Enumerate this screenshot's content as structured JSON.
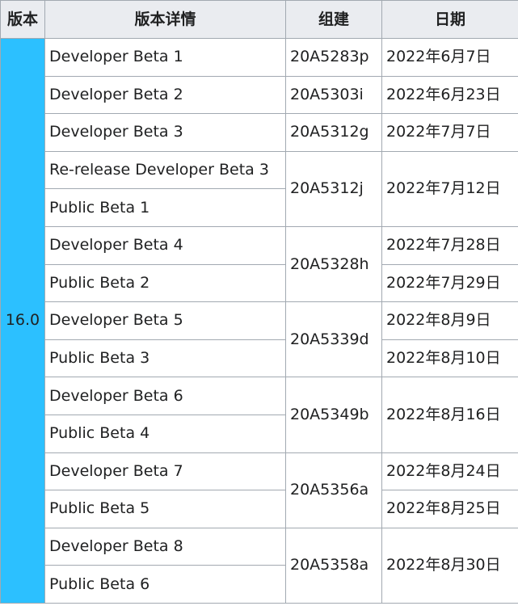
{
  "table": {
    "headers": {
      "version": "版本",
      "details": "版本详情",
      "build": "组建",
      "date": "日期"
    },
    "version": "16.0",
    "rows": [
      {
        "details": "Developer Beta 1",
        "build": "20A5283p",
        "date": "2022年6月7日"
      },
      {
        "details": "Developer Beta 2",
        "build": "20A5303i",
        "date": "2022年6月23日"
      },
      {
        "details": "Developer Beta 3",
        "build": "20A5312g",
        "date": "2022年7月7日"
      },
      {
        "details": "Re-release Developer Beta 3",
        "build": "20A5312j",
        "date": "2022年7月12日"
      },
      {
        "details": "Public Beta 1"
      },
      {
        "details": "Developer Beta 4",
        "build": "20A5328h",
        "date": "2022年7月28日"
      },
      {
        "details": "Public Beta 2",
        "date": "2022年7月29日"
      },
      {
        "details": "Developer Beta 5",
        "build": "20A5339d",
        "date": "2022年8月9日"
      },
      {
        "details": "Public Beta 3",
        "date": "2022年8月10日"
      },
      {
        "details": "Developer Beta 6",
        "build": "20A5349b",
        "date": "2022年8月16日"
      },
      {
        "details": "Public Beta 4"
      },
      {
        "details": "Developer Beta 7",
        "build": "20A5356a",
        "date": "2022年8月24日"
      },
      {
        "details": "Public Beta 5",
        "date": "2022年8月25日"
      },
      {
        "details": "Developer Beta 8",
        "build": "20A5358a",
        "date": "2022年8月30日"
      },
      {
        "details": "Public Beta 6"
      }
    ]
  },
  "colors": {
    "version_cell_bg": "#2cc0ff",
    "header_bg": "#eaecf0",
    "border": "#a2a9b1"
  }
}
